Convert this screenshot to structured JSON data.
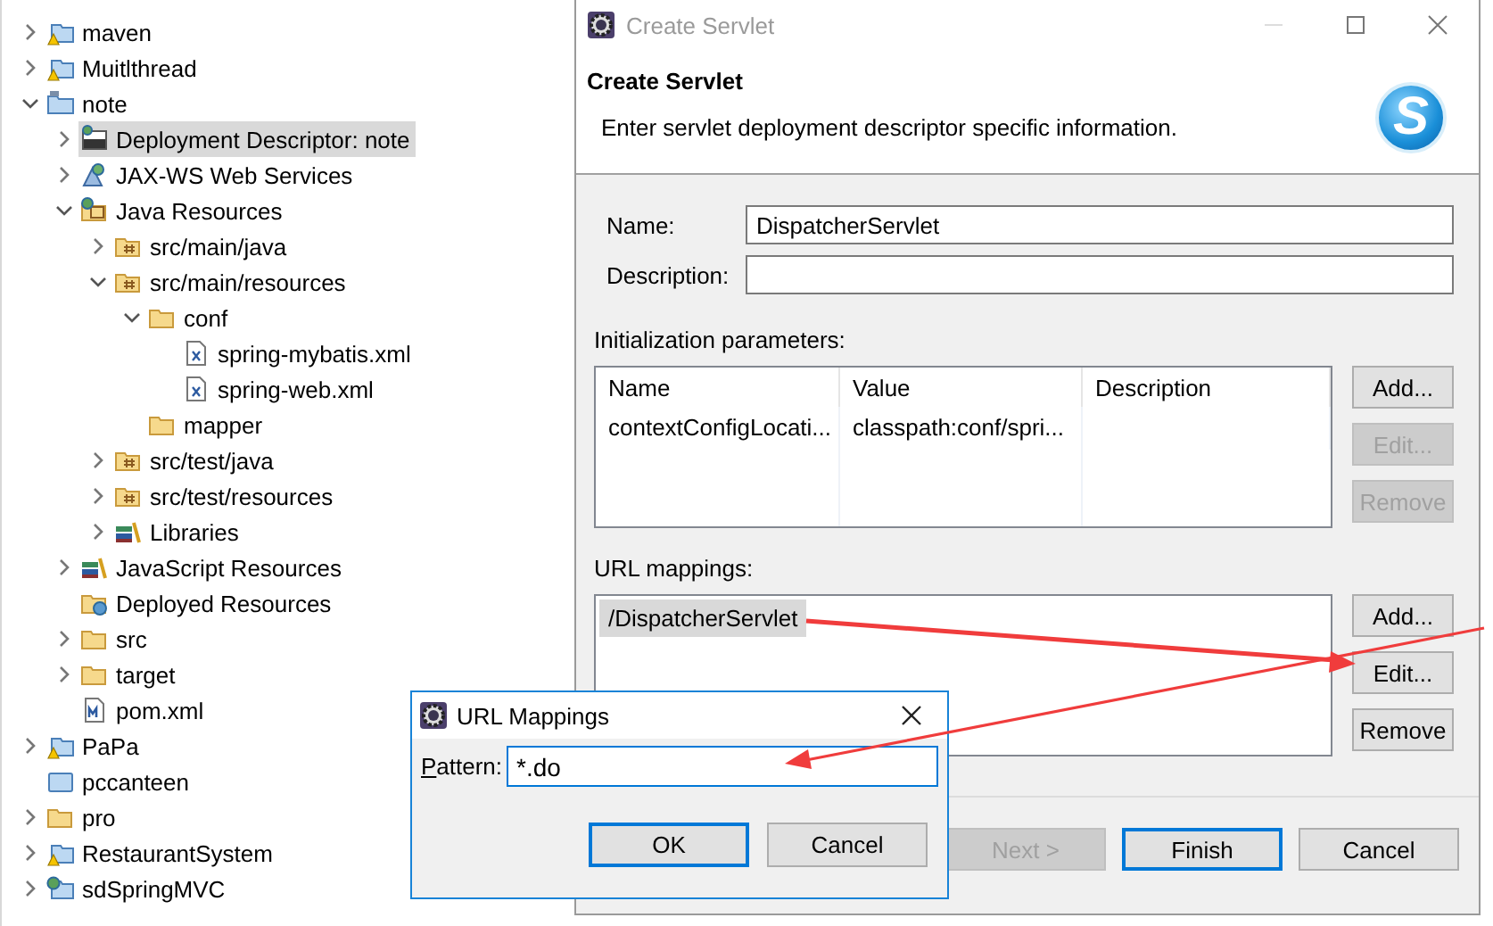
{
  "tree": [
    {
      "label": "maven",
      "kind": "project-warning",
      "expanded": false,
      "selected": false
    },
    {
      "label": "Muitlthread",
      "kind": "project-warning",
      "expanded": false,
      "selected": false
    },
    {
      "label": "note",
      "kind": "project",
      "expanded": true,
      "selected": false,
      "children": [
        {
          "label": "Deployment Descriptor: note",
          "kind": "descriptor",
          "expanded": false,
          "selected": true
        },
        {
          "label": "JAX-WS Web Services",
          "kind": "webservices",
          "expanded": false,
          "selected": false
        },
        {
          "label": "Java Resources",
          "kind": "java-resources",
          "expanded": true,
          "selected": false,
          "children": [
            {
              "label": "src/main/java",
              "kind": "package-folder",
              "expanded": false,
              "selected": false
            },
            {
              "label": "src/main/resources",
              "kind": "package-folder",
              "expanded": true,
              "selected": false,
              "children": [
                {
                  "label": "conf",
                  "kind": "folder",
                  "expanded": true,
                  "selected": false,
                  "children": [
                    {
                      "label": "spring-mybatis.xml",
                      "kind": "xml-file",
                      "selected": false
                    },
                    {
                      "label": "spring-web.xml",
                      "kind": "xml-file",
                      "selected": false
                    }
                  ]
                },
                {
                  "label": "mapper",
                  "kind": "folder",
                  "selected": false
                }
              ]
            },
            {
              "label": "src/test/java",
              "kind": "package-folder",
              "expanded": false,
              "selected": false
            },
            {
              "label": "src/test/resources",
              "kind": "package-folder",
              "expanded": false,
              "selected": false
            },
            {
              "label": "Libraries",
              "kind": "libraries",
              "expanded": false,
              "selected": false
            }
          ]
        },
        {
          "label": "JavaScript Resources",
          "kind": "libraries",
          "expanded": false,
          "selected": false
        },
        {
          "label": "Deployed Resources",
          "kind": "deployed",
          "selected": false
        },
        {
          "label": "src",
          "kind": "folder",
          "expanded": false,
          "selected": false
        },
        {
          "label": "target",
          "kind": "folder",
          "expanded": false,
          "selected": false
        },
        {
          "label": "pom.xml",
          "kind": "pom",
          "selected": false
        }
      ]
    },
    {
      "label": "PaPa",
      "kind": "project-warning",
      "expanded": false,
      "selected": false
    },
    {
      "label": "pccanteen",
      "kind": "plain-project",
      "selected": false
    },
    {
      "label": "pro",
      "kind": "folder",
      "expanded": false,
      "selected": false
    },
    {
      "label": "RestaurantSystem",
      "kind": "project-warning",
      "expanded": false,
      "selected": false
    },
    {
      "label": "sdSpringMVC",
      "kind": "web-project",
      "expanded": false,
      "selected": false
    }
  ],
  "dialog": {
    "title": "Create Servlet",
    "header_title": "Create Servlet",
    "header_text": "Enter servlet deployment descriptor specific information.",
    "logo": "S",
    "fields": [
      {
        "label": "Name:",
        "value": "DispatcherServlet"
      },
      {
        "label": "Description:"
      }
    ],
    "init_label": "Initialization parameters:",
    "init_columns": [
      "Name",
      "Value",
      "Description"
    ],
    "init_rows": [
      {
        "name": "contextConfigLocati...",
        "value": "classpath:conf/spri..."
      }
    ],
    "init_buttons": [
      {
        "label": "Add...",
        "disabled": false
      },
      {
        "label": "Edit...",
        "disabled": true
      },
      {
        "label": "Remove",
        "disabled": true
      }
    ],
    "url_label": "URL mappings:",
    "url_items": [
      {
        "label": "/DispatcherServlet",
        "selected": true
      }
    ],
    "url_buttons": [
      {
        "label": "Add...",
        "disabled": false
      },
      {
        "label": "Edit...",
        "disabled": false
      },
      {
        "label": "Remove",
        "disabled": false
      }
    ],
    "buttons": [
      {
        "label": "Next >",
        "disabled": true,
        "default": false
      },
      {
        "label": "Finish",
        "disabled": false,
        "default": true
      },
      {
        "label": "Cancel",
        "disabled": false,
        "default": false
      }
    ]
  },
  "popup": {
    "title": "URL Mappings",
    "field_label": "Pattern:",
    "field_value": "*.do",
    "buttons": [
      {
        "label": "OK",
        "default": true
      },
      {
        "label": "Cancel",
        "default": false
      }
    ]
  }
}
